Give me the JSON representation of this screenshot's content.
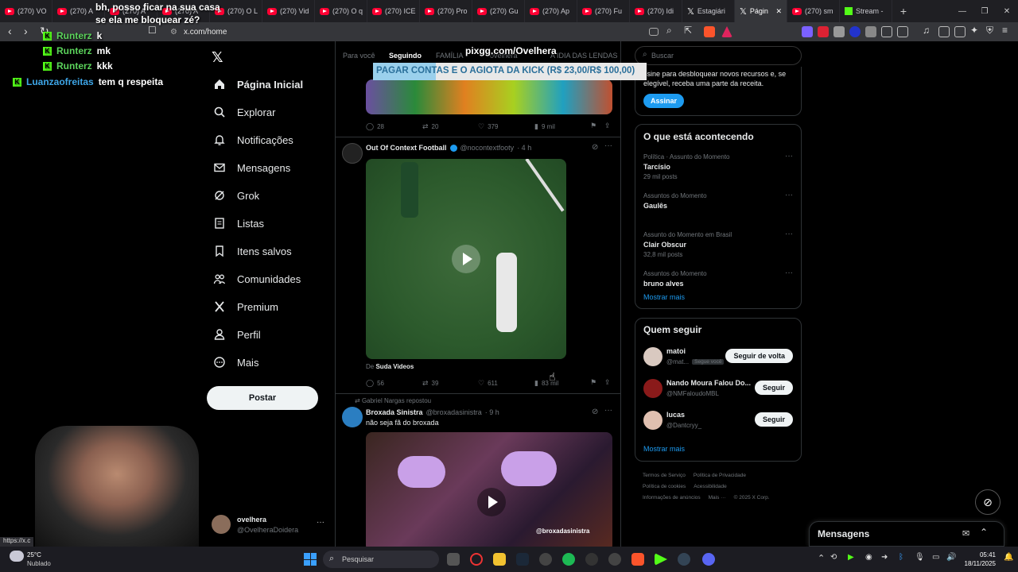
{
  "browser": {
    "tabs": [
      {
        "label": "(270) VO",
        "icon": "youtube-icon"
      },
      {
        "label": "(270) A",
        "icon": "youtube-icon"
      },
      {
        "label": "(270) A",
        "icon": "youtube-icon"
      },
      {
        "label": "(270) A",
        "icon": "youtube-icon"
      },
      {
        "label": "(270) O L",
        "icon": "youtube-icon"
      },
      {
        "label": "(270) Vid",
        "icon": "youtube-icon"
      },
      {
        "label": "(270) O q",
        "icon": "youtube-icon"
      },
      {
        "label": "(270) ICE",
        "icon": "youtube-icon"
      },
      {
        "label": "(270) Pro",
        "icon": "youtube-icon"
      },
      {
        "label": "(270) Gu",
        "icon": "youtube-icon"
      },
      {
        "label": "(270) Ap",
        "icon": "youtube-icon"
      },
      {
        "label": "(270) Fu",
        "icon": "youtube-icon"
      },
      {
        "label": "(270) Idi",
        "icon": "youtube-icon"
      },
      {
        "label": "Estagiári",
        "icon": "x-icon"
      },
      {
        "label": "Págin",
        "icon": "x-icon",
        "active": true
      },
      {
        "label": "(270) sm",
        "icon": "youtube-icon"
      },
      {
        "label": "Stream -",
        "icon": "kick-icon"
      }
    ],
    "url": "x.com/home",
    "status_url": "https://x.c"
  },
  "chat": {
    "top_message": "bh, posso ficar na sua casa se ela me bloquear zé?",
    "lines": [
      {
        "user": "Runterz",
        "msg": "k"
      },
      {
        "user": "Runterz",
        "msg": "mk"
      },
      {
        "user": "Runterz",
        "msg": "kkk"
      },
      {
        "user": "Luanzaofreitas",
        "msg": "tem q respeita"
      }
    ]
  },
  "overlay": {
    "site": "pixgg.com/Ovelhera",
    "banner": "PAGAR CONTAS E O AGIOTA DA KICK (R$ 23,00/R$ 100,00)",
    "goal_progress": 0.23
  },
  "nav": {
    "items": [
      {
        "label": "Página Inicial",
        "icon": "home-icon"
      },
      {
        "label": "Explorar",
        "icon": "search-icon"
      },
      {
        "label": "Notificações",
        "icon": "bell-icon"
      },
      {
        "label": "Mensagens",
        "icon": "mail-icon"
      },
      {
        "label": "Grok",
        "icon": "grok-icon"
      },
      {
        "label": "Listas",
        "icon": "list-icon"
      },
      {
        "label": "Itens salvos",
        "icon": "bookmark-icon"
      },
      {
        "label": "Comunidades",
        "icon": "people-icon"
      },
      {
        "label": "Premium",
        "icon": "x-icon"
      },
      {
        "label": "Perfil",
        "icon": "person-icon"
      },
      {
        "label": "Mais",
        "icon": "more-icon"
      }
    ],
    "post_label": "Postar",
    "account": {
      "name": "ovelhera",
      "handle": "@OvelheraDoidera"
    }
  },
  "feed": {
    "tabs": [
      "Para você",
      "Seguindo",
      "FAMÍLIA",
      "ovelhera",
      "A IDIA DAS LENDAS"
    ],
    "post0_actions": {
      "replies": "28",
      "reposts": "20",
      "likes": "379",
      "views": "9 mil"
    },
    "post1": {
      "author": "Out Of Context Football",
      "handle": "@nocontextfooty",
      "time": "· 4 h",
      "from_label": "De",
      "from_source": "Suda Videos",
      "actions": {
        "replies": "56",
        "reposts": "39",
        "likes": "611",
        "views": "83 mil"
      }
    },
    "post2": {
      "repost_note": "Gabriel Nargas repostou",
      "author": "Broxada Sinistra",
      "handle": "@broxadasinistra",
      "time": "· 9 h",
      "text": "não seja fã do broxada",
      "watermark": "@broxadasinistra"
    }
  },
  "right": {
    "search_placeholder": "Buscar",
    "premium_text": "ssine para desbloquear novos recursos e, se elegível, receba uma parte da receita.",
    "subscribe_label": "Assinar",
    "trends_title": "O que está acontecendo",
    "trends": [
      {
        "context": "Política · Assunto do Momento",
        "name": "Tarcísio",
        "posts": "29 mil posts"
      },
      {
        "context": "Assuntos do Momento",
        "name": "Gaulês",
        "posts": ""
      },
      {
        "context": "Assunto do Momento em Brasil",
        "name": "Clair Obscur",
        "posts": "32,8 mil posts"
      },
      {
        "context": "Assuntos do Momento",
        "name": "bruno alves",
        "posts": ""
      }
    ],
    "show_more": "Mostrar mais",
    "who_title": "Quem seguir",
    "who": [
      {
        "name": "matoi",
        "handle": "@mat...",
        "badge": "Segue você",
        "button": "Seguir de volta"
      },
      {
        "name": "Nando Moura Falou Do...",
        "handle": "@NMFaloudoMBL",
        "badge": "",
        "button": "Seguir"
      },
      {
        "name": "lucas",
        "handle": "@Dantcryy_",
        "badge": "",
        "button": "Seguir"
      }
    ],
    "footer": [
      "Termos de Serviço",
      "Política de Privacidade",
      "Política de cookies",
      "Acessibilidade",
      "Informações de anúncios",
      "Mais ···",
      "© 2025 X Corp."
    ],
    "messages_label": "Mensagens"
  },
  "taskbar": {
    "weather_temp": "25°C",
    "weather_desc": "Nublado",
    "search_placeholder": "Pesquisar",
    "time": "05:41",
    "date": "18/11/2025"
  },
  "colors": {
    "kick_green": "#53fc18",
    "x_blue": "#1d9bf0",
    "youtube_red": "#ff0033"
  }
}
